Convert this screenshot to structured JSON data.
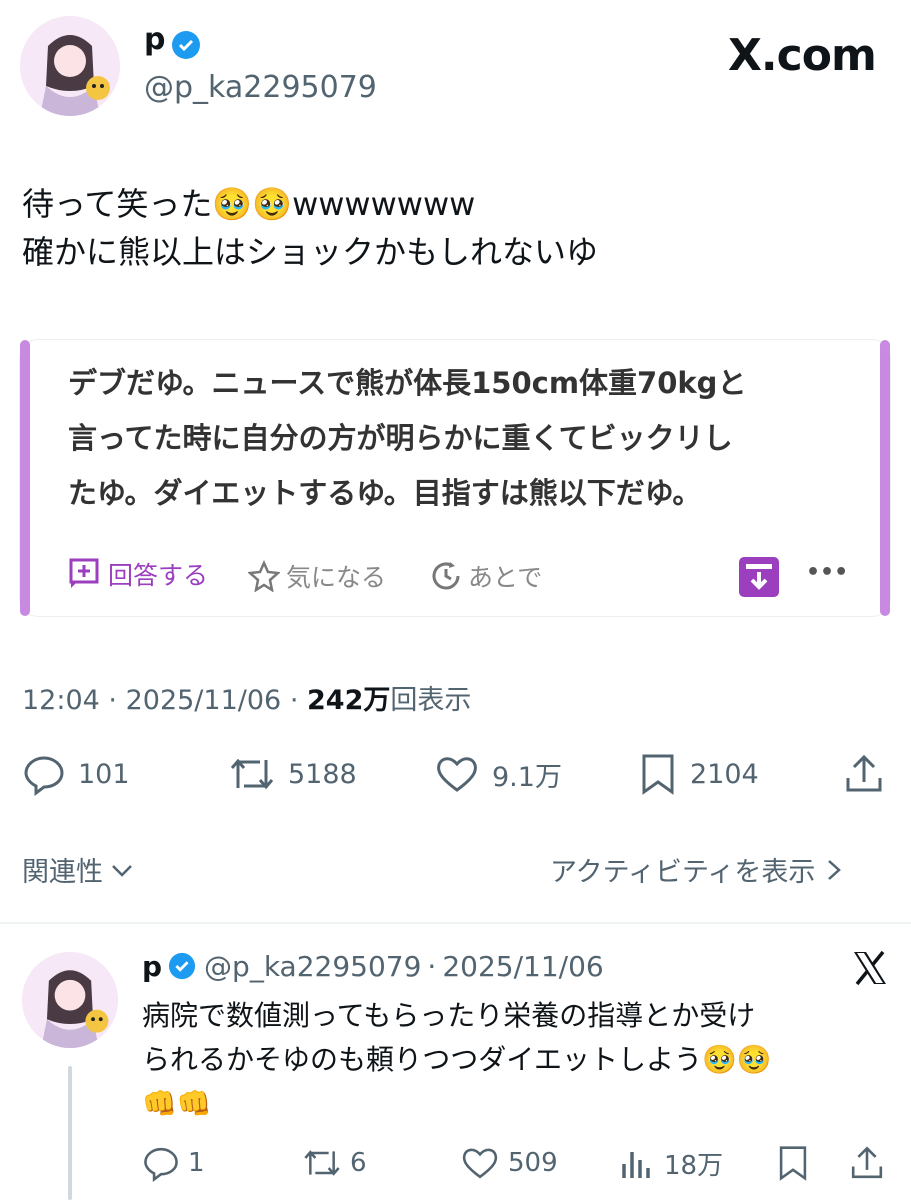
{
  "header": {
    "display_name": "p",
    "handle": "@p_ka2295079",
    "brand": "X.com"
  },
  "tweet": {
    "text": "待って笑った🥹🥹wwwwwww\n確かに熊以上はショックかもしれないゆ",
    "quote": {
      "text": "デブだゆ。ニュースで熊が体長150cm体重70kgと\n言ってた時に自分の方が明らかに重くてビックリし\nたゆ。ダイエットするゆ。目指すは熊以下だゆ。",
      "actions": {
        "answer": "回答する",
        "interested": "気になる",
        "later": "あとで",
        "more": "•••"
      }
    },
    "time": "12:04",
    "date": "2025/11/06",
    "views_count": "242万",
    "views_label": "回表示",
    "separator": "·",
    "stats": {
      "replies": "101",
      "retweets": "5188",
      "likes": "9.1万",
      "bookmarks": "2104"
    }
  },
  "filter": {
    "relevance": "関連性",
    "activity": "アクティビティを表示"
  },
  "reply": {
    "display_name": "p",
    "handle": "@p_ka2295079",
    "date": "2025/11/06",
    "separator": "·",
    "text": "病院で数値測ってもらったり栄養の指導とか受け\nられるかそゆのも頼りつつダイエットしよう🥹🥹\n👊👊",
    "stats": {
      "replies": "1",
      "retweets": "6",
      "likes": "509",
      "views": "18万"
    }
  },
  "colors": {
    "accent_purple": "#9b3fbf",
    "quote_bar": "#c88ae0",
    "verified_blue": "#1d9bf0",
    "muted": "#536471"
  }
}
